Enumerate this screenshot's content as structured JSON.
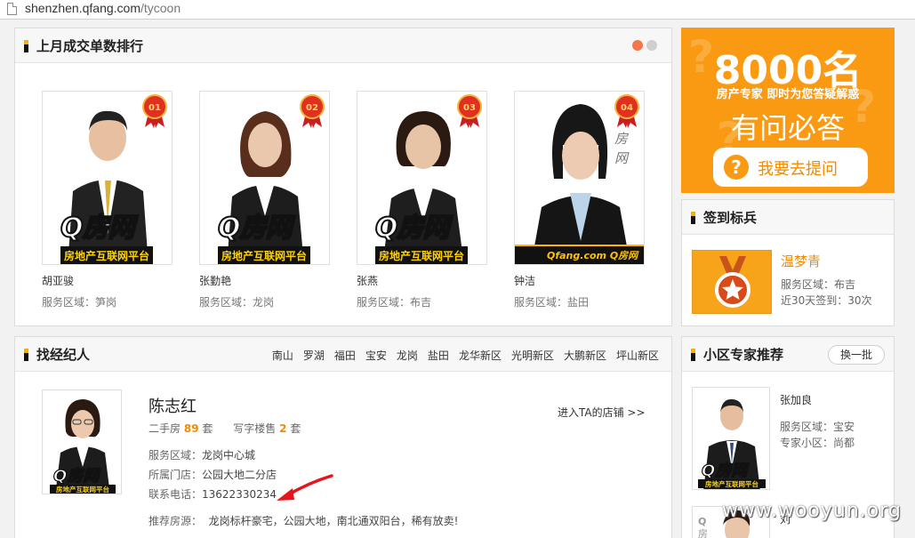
{
  "browser": {
    "url_host": "shenzhen.qfang.com",
    "url_path": "/tycoon"
  },
  "ranking": {
    "title": "上月成交单数排行",
    "agents": [
      {
        "rank": "01",
        "name": "胡亚骏",
        "area_label": "服务区域：",
        "area": "笋岗",
        "logo_text": "Q房网",
        "logo_sub": "房地产互联网平台"
      },
      {
        "rank": "02",
        "name": "张勤艳",
        "area_label": "服务区域：",
        "area": "龙岗",
        "logo_text": "Q房网",
        "logo_sub": "房地产互联网平台"
      },
      {
        "rank": "03",
        "name": "张燕",
        "area_label": "服务区域：",
        "area": "布吉",
        "logo_text": "Q房网",
        "logo_sub": "房地产互联网平台"
      },
      {
        "rank": "04",
        "name": "钟洁",
        "area_label": "服务区域：",
        "area": "盐田",
        "logo_text": "Qfang.com Q房网",
        "logo_sub": ""
      }
    ]
  },
  "ad": {
    "number": "8000名",
    "subtitle": "房产专家 即时为您答疑解惑",
    "slogan": "有问必答",
    "button_label": "我要去提问"
  },
  "checkin": {
    "title": "签到标兵",
    "name": "温梦青",
    "area_label": "服务区域：",
    "area": "布吉",
    "days_label": "近30天签到：",
    "days": "30次"
  },
  "find_agent": {
    "title": "找经纪人",
    "districts": [
      "南山",
      "罗湖",
      "福田",
      "宝安",
      "龙岗",
      "盐田",
      "龙华新区",
      "光明新区",
      "大鹏新区",
      "坪山新区"
    ],
    "agent": {
      "name": "陈志红",
      "second_hand_label": "二手房",
      "second_hand_count": "89",
      "unit1": "套",
      "office_label": "写字楼售",
      "office_count": "2",
      "unit2": "套",
      "area_label": "服务区域：",
      "area": "龙岗中心城",
      "store_label": "所属门店：",
      "store": "公园大地二分店",
      "phone_label": "联系电话：",
      "phone": "13622330234",
      "recommend_label": "推荐房源：",
      "recommend": "龙岗标杆豪宅，公园大地，南北通双阳台，稀有放卖!",
      "shop_link": "进入TA的店铺 >>"
    }
  },
  "experts": {
    "title": "小区专家推荐",
    "refresh_label": "换一批",
    "items": [
      {
        "name": "张加良",
        "area_label": "服务区域：",
        "area": "宝安",
        "community_label": "专家小区：",
        "community": "尚都"
      },
      {
        "name": "刘"
      }
    ]
  },
  "watermark": "www.wooyun.org",
  "colors": {
    "accent": "#f38a00",
    "ad_bg": "#f99a12",
    "arrow": "#e8141b"
  }
}
